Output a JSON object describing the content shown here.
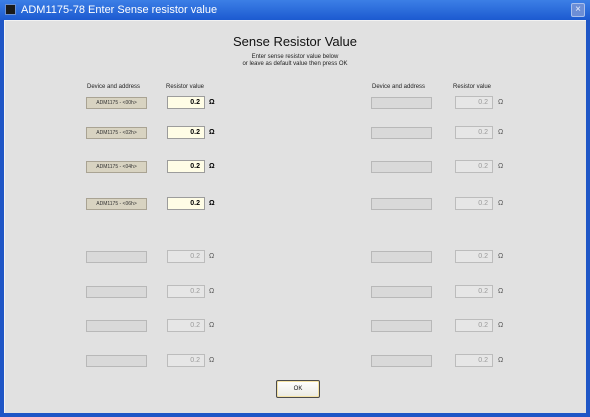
{
  "window": {
    "title": "ADM1175-78 Enter Sense resistor value",
    "close_glyph": "×"
  },
  "heading": "Sense Resistor Value",
  "instructions": {
    "line1": "Enter sense resistor value below",
    "line2": "or leave as default value then press OK"
  },
  "columns": {
    "device": "Device and address",
    "resistor": "Resistor value"
  },
  "unit": "Ω",
  "ok_label": "OK",
  "rows_left": [
    {
      "device": "ADM1175 - <00h>",
      "value": "0.2",
      "enabled": true
    },
    {
      "device": "ADM1175 - <02h>",
      "value": "0.2",
      "enabled": true
    },
    {
      "device": "ADM1175 - <04h>",
      "value": "0.2",
      "enabled": true
    },
    {
      "device": "ADM1175 - <06h>",
      "value": "0.2",
      "enabled": true
    },
    {
      "device": "",
      "value": "0.2",
      "enabled": false
    },
    {
      "device": "",
      "value": "0.2",
      "enabled": false
    },
    {
      "device": "",
      "value": "0.2",
      "enabled": false
    },
    {
      "device": "",
      "value": "0.2",
      "enabled": false
    }
  ],
  "rows_right": [
    {
      "device": "",
      "value": "0.2",
      "enabled": false
    },
    {
      "device": "",
      "value": "0.2",
      "enabled": false
    },
    {
      "device": "",
      "value": "0.2",
      "enabled": false
    },
    {
      "device": "",
      "value": "0.2",
      "enabled": false
    },
    {
      "device": "",
      "value": "0.2",
      "enabled": false
    },
    {
      "device": "",
      "value": "0.2",
      "enabled": false
    },
    {
      "device": "",
      "value": "0.2",
      "enabled": false
    },
    {
      "device": "",
      "value": "0.2",
      "enabled": false
    }
  ]
}
